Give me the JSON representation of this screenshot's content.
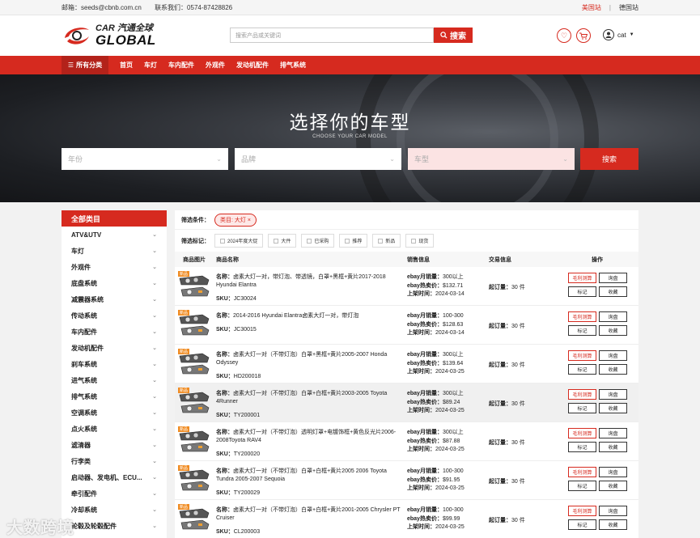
{
  "topbar": {
    "email": "邮箱：seeds@cbnb.com.cn",
    "phone": "联系我们：0574-87428826",
    "site_us": "美国站",
    "sep": "|",
    "site_de": "德国站"
  },
  "header": {
    "logo_line1": "CAR 汽通全球",
    "logo_line2": "GLOBAL",
    "search_placeholder": "搜索产品或关键词",
    "search_button": "搜索",
    "user_name": "cat"
  },
  "nav": {
    "all": "所有分类",
    "items": [
      "首页",
      "车灯",
      "车内配件",
      "外观件",
      "发动机配件",
      "排气系统"
    ]
  },
  "hero": {
    "title": "选择你的车型",
    "subtitle": "CHOOSE YOUR CAR MODEL",
    "year": "年份",
    "brand": "品牌",
    "model": "车型",
    "button": "搜索"
  },
  "sidebar": {
    "title": "全部类目",
    "items": [
      "ATV&UTV",
      "车灯",
      "外观件",
      "底盘系统",
      "减震器系统",
      "传动系统",
      "车内配件",
      "发动机配件",
      "刹车系统",
      "进气系统",
      "排气系统",
      "空调系统",
      "点火系统",
      "滤清器",
      "行李类",
      "启动器、发电机、ECU...",
      "牵引配件",
      "冷却系统",
      "轮毂及轮毂配件"
    ]
  },
  "filter": {
    "label": "筛选条件：",
    "chip": "类目: 大灯",
    "chip_close": "×",
    "tags_label": "筛选标记：",
    "tags": [
      "2024年度大促",
      "大件",
      "已采购",
      "推荐",
      "新品",
      "现货"
    ]
  },
  "table": {
    "headers": [
      "商品图片",
      "商品名称",
      "销售信息",
      "交易信息",
      "操作"
    ],
    "name_label": "名称：",
    "sku_label": "SKU：",
    "sales_label": "ebay月销量：",
    "price_label": "ebay热卖价：",
    "date_label": "上架时间：",
    "moq_label": "起订量：",
    "btn_profit": "毛利测算",
    "btn_inquiry": "询盘",
    "btn_mark": "标记",
    "btn_fav": "收藏",
    "rows": [
      {
        "name": "卤素大灯一对，带灯泡、带透镜，白罩+黑框+黄片2017-2018 Hyundai Elantra",
        "sku": "JC30024",
        "sales": "300以上",
        "price": "$132.71",
        "date": "2024-03-14",
        "moq": "30 件",
        "badge": "新品",
        "lines": 2
      },
      {
        "name": "2014-2016 Hyundai Elantra卤素大灯一对，带灯泡",
        "sku": "JC30015",
        "sales": "100-300",
        "price": "$128.63",
        "date": "2024-03-14",
        "moq": "30 件",
        "badge": "新品",
        "lines": 1
      },
      {
        "name": "卤素大灯一对（不带灯泡）白罩+黑框+黄片2005-2007 Honda Odyssey",
        "sku": "HD200018",
        "sales": "300以上",
        "price": "$139.64",
        "date": "2024-03-25",
        "moq": "30 件",
        "badge": "新品",
        "lines": 2
      },
      {
        "name": "卤素大灯一对（不带灯泡）白罩+白框+黄片2003-2005 Toyota 4Runner",
        "sku": "TY200001",
        "sales": "300以上",
        "price": "$89.24",
        "date": "2024-03-25",
        "moq": "30 件",
        "badge": "新品",
        "lines": 2
      },
      {
        "name": "卤素大灯一对（不带灯泡）透明灯罩+电镀饰框+黄色反光片2006-2008Toyota RAV4",
        "sku": "TY200020",
        "sales": "300以上",
        "price": "$87.88",
        "date": "2024-03-25",
        "moq": "30 件",
        "badge": "新品",
        "lines": 2
      },
      {
        "name": "卤素大灯一对（不带灯泡）白罩+白框+黄片2005 2006 Toyota Tundra 2005-2007 Sequoia",
        "sku": "TY200029",
        "sales": "100-300",
        "price": "$91.95",
        "date": "2024-03-25",
        "moq": "30 件",
        "badge": "新品",
        "lines": 2
      },
      {
        "name": "卤素大灯一对（不带灯泡）白罩+白框+黄片2001-2005 Chrysler PT Cruiser",
        "sku": "CL200003",
        "sales": "100-300",
        "price": "$99.99",
        "date": "2024-03-25",
        "moq": "30 件",
        "badge": "新品",
        "lines": 2
      }
    ]
  },
  "watermark": "大数跨境",
  "colors": {
    "accent": "#d62a1f",
    "badge": "#f08c23"
  }
}
